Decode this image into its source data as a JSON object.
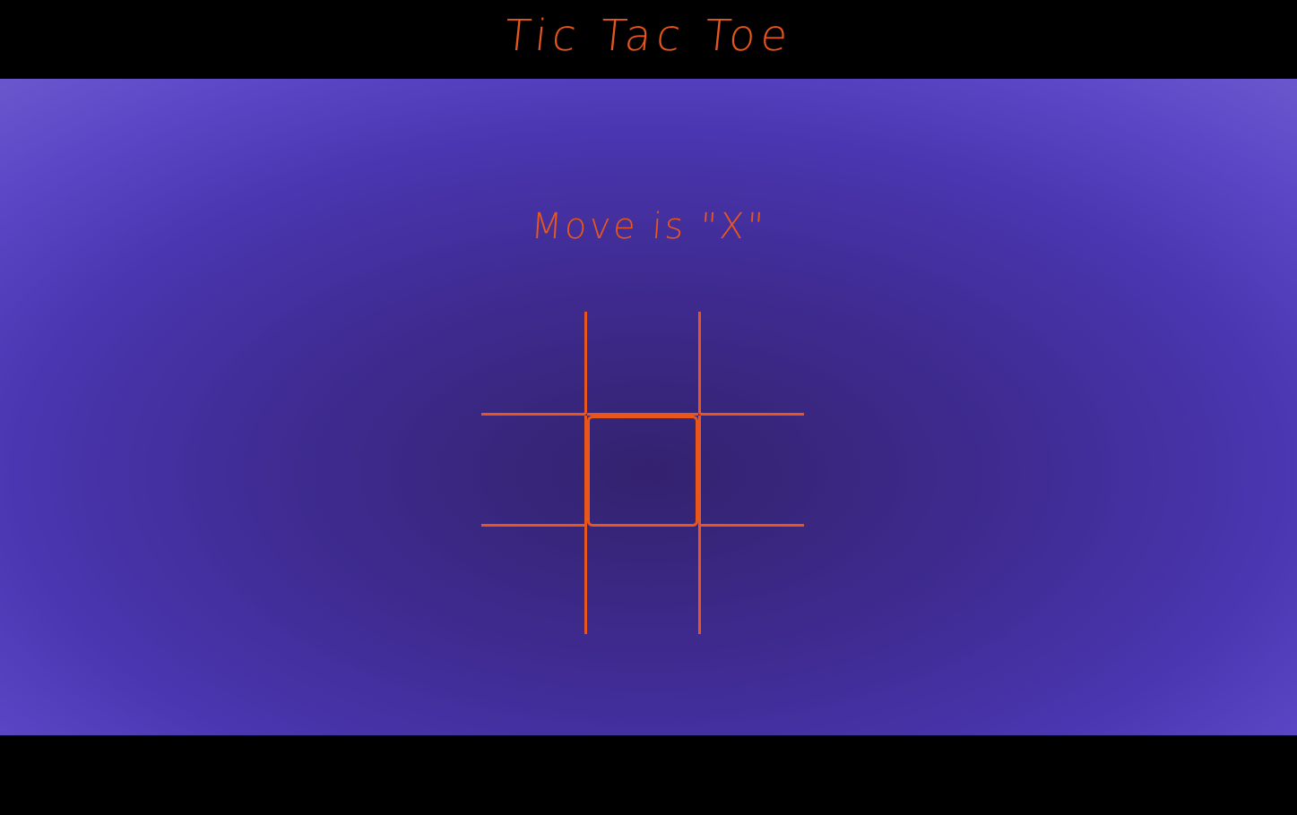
{
  "header": {
    "title": "Tic Tac Toe"
  },
  "game": {
    "status": "Move is \"X\"",
    "board": [
      "",
      "",
      "",
      "",
      "",
      "",
      "",
      "",
      ""
    ]
  },
  "colors": {
    "accent": "#e8561c",
    "header_bg": "#000000",
    "board_bg_center": "#33226e",
    "board_bg_edge": "#6a56cc"
  }
}
